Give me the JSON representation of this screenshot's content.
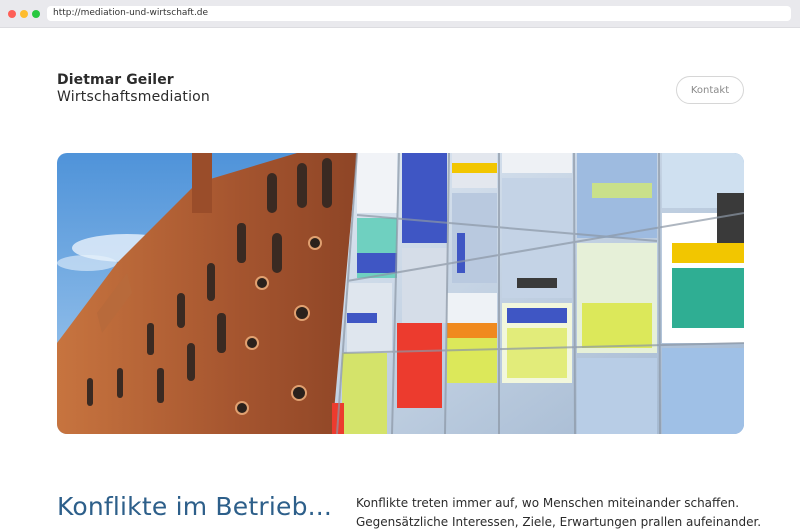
{
  "browser": {
    "url": "http://mediation-und-wirtschaft.de"
  },
  "header": {
    "name": "Dietmar Geiler",
    "subtitle": "Wirtschaftsmediation",
    "contact_label": "Kontakt"
  },
  "hero": {
    "image_alt": "Brick warehouse next to a colorful glass facade",
    "icon": "hero-photo"
  },
  "section": {
    "headline": "Konflikte im Betrieb...",
    "intro_line1": "Konflikte treten immer auf, wo Menschen miteinander schaffen.",
    "intro_line2": "Gegensätzliche Interessen, Ziele, Erwartungen prallen aufeinander."
  },
  "colors": {
    "headline": "#2d5f8a",
    "sky": "#6aa8df",
    "brick": "#a5552f"
  }
}
